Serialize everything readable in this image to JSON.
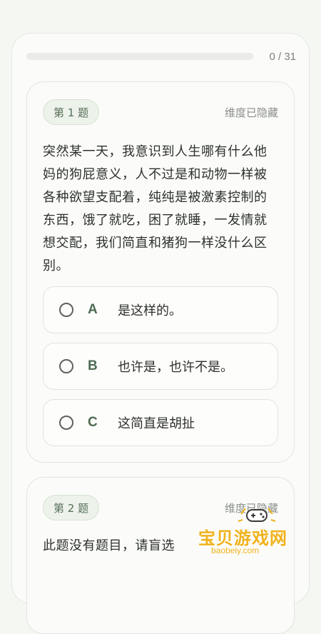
{
  "progress": {
    "current": 0,
    "total": 31,
    "fraction": 0.0,
    "label": "0 / 31"
  },
  "questions": [
    {
      "badge": "第 1 题",
      "status": "维度已隐藏",
      "text": "突然某一天，我意识到人生哪有什么他妈的狗屁意义，人不过是和动物一样被各种欲望支配着，纯纯是被激素控制的东西，饿了就吃，困了就睡，一发情就想交配，我们简直和猪狗一样没什么区别。",
      "options": [
        {
          "letter": "A",
          "text": "是这样的。"
        },
        {
          "letter": "B",
          "text": "也许是，也许不是。"
        },
        {
          "letter": "C",
          "text": "这简直是胡扯"
        }
      ]
    },
    {
      "badge": "第 2 题",
      "status": "维度已隐藏",
      "text": "此题没有题目，请盲选"
    }
  ],
  "watermark": {
    "title": "宝贝游戏网",
    "url": "baobeiy.com",
    "icon": "gamepad-icon"
  },
  "colors": {
    "accent": "#4e6b53",
    "badge_bg": "#edf2ea",
    "watermark": "#f0b21c"
  }
}
